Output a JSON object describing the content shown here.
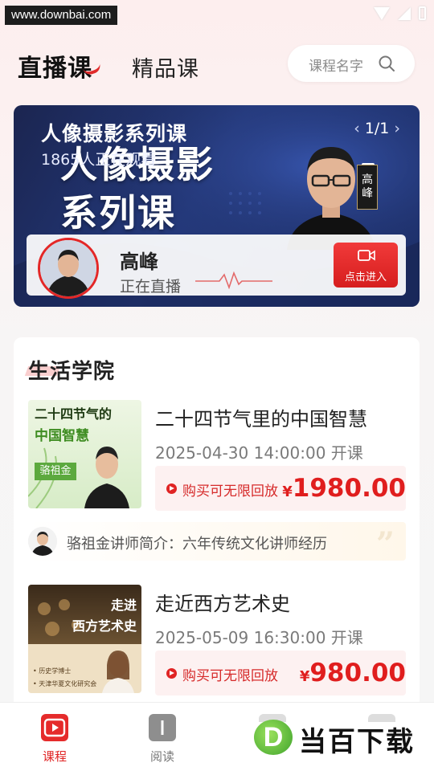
{
  "status_bar": {
    "watermark_url": "www.downbai.com"
  },
  "header": {
    "tabs": [
      {
        "label": "直播课",
        "active": true
      },
      {
        "label": "精品课",
        "active": false
      }
    ],
    "search": {
      "placeholder": "课程名字"
    }
  },
  "banner": {
    "title": "人像摄影系列课",
    "viewers": "1865人正在观看",
    "big_title_line1": "人像摄影",
    "big_title_line2": "系列课",
    "pager": "1/1",
    "name_tag": "高峰",
    "live": {
      "host": "高峰",
      "status": "正在直播",
      "enter_label": "点击进入"
    }
  },
  "section": {
    "title": "生活学院",
    "courses": [
      {
        "title": "二十四节气里的中国智慧",
        "time": "2025-04-30 14:00:00 开课",
        "replay": "购买可无限回放",
        "price_symbol": "¥",
        "price": "1980.00",
        "cover": {
          "line1": "二十四节气的",
          "line2": "中国智慧",
          "name": "骆祖金"
        }
      },
      {
        "title": "走近西方艺术史",
        "time": "2025-05-09 16:30:00 开课",
        "replay": "购买可无限回放",
        "price_symbol": "¥",
        "price": "980.00",
        "cover": {
          "line1": "走进",
          "line2": "西方艺术史",
          "bullet1": "• 历史学博士",
          "bullet2": "• 天津华夏文化研究会"
        }
      }
    ],
    "teacher_intro": "骆祖金讲师简介：六年传统文化讲师经历"
  },
  "bottom_nav": {
    "items": [
      {
        "label": "课程",
        "active": true
      },
      {
        "label": "阅读",
        "active": false
      }
    ]
  },
  "logo_watermark": {
    "letter": "D",
    "text": "当百下载"
  },
  "colors": {
    "accent": "#e02424",
    "price": "#e01e1e",
    "banner_bg": "#243a7e"
  }
}
